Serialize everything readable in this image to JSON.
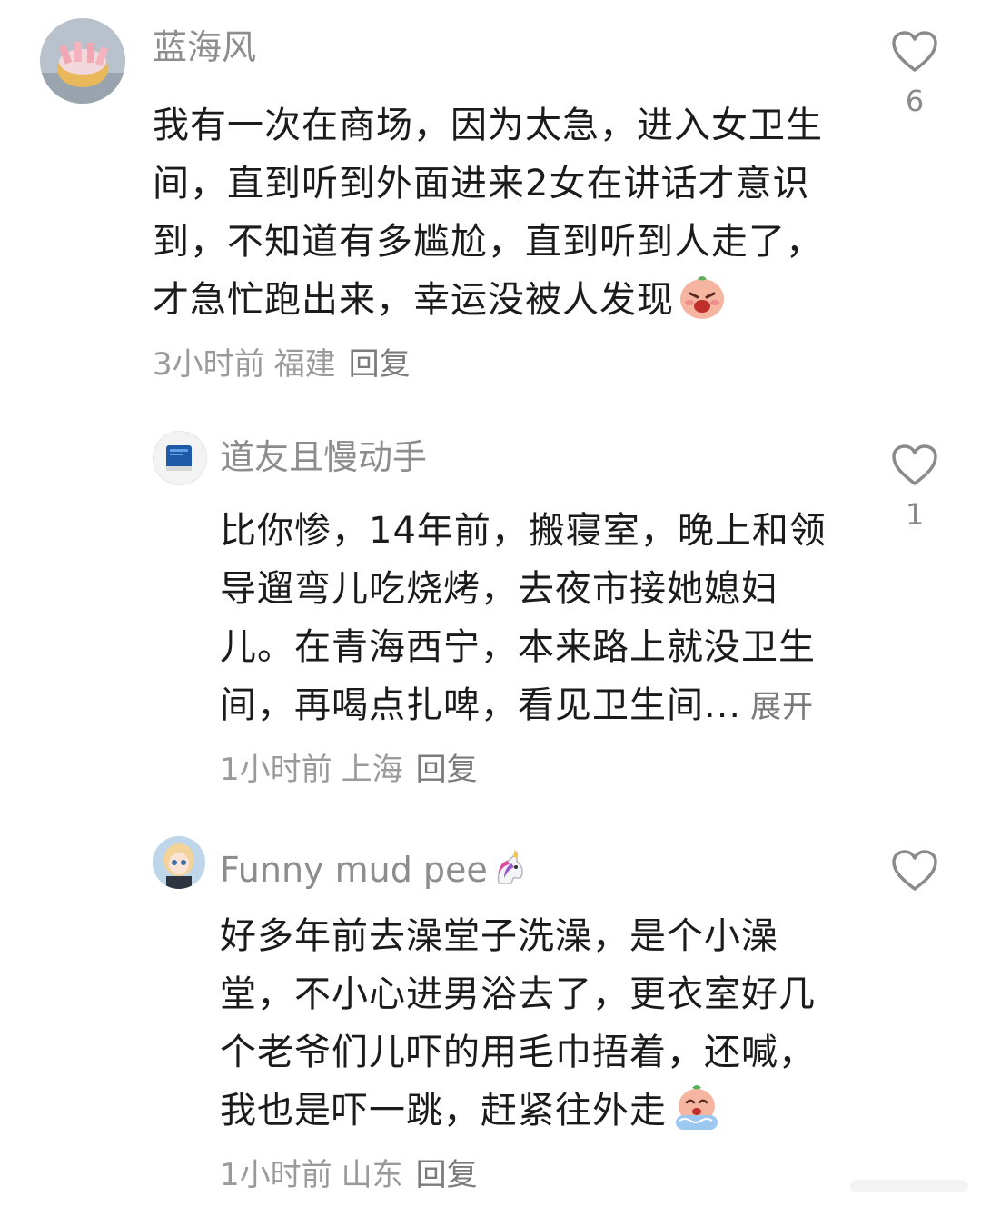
{
  "comments": [
    {
      "username": "蓝海风",
      "lines": [
        "我有一次在商场，因为太急，进入女卫生",
        "间，直到听到外面进来2女在讲话才意识",
        "到，不知道有多尴尬，直到听到人走了，",
        "才急忙跑出来，幸运没被人发现"
      ],
      "emoji": "embarrassed-emoji",
      "time": "3小时前",
      "location": "福建",
      "reply_label": "回复",
      "like_count": "6"
    },
    {
      "username": "道友且慢动手",
      "lines": [
        "比你惨，14年前，搬寝室，晚上和领",
        "导遛弯儿吃烧烤，去夜市接她媳妇",
        "儿。在青海西宁，本来路上就没卫生",
        "间，再喝点扎啤，看见卫生间..."
      ],
      "expand_label": "展开",
      "time": "1小时前",
      "location": "上海",
      "reply_label": "回复",
      "like_count": "1"
    },
    {
      "username": "Funny mud pee",
      "username_emoji": "unicorn-emoji",
      "lines": [
        "好多年前去澡堂子洗澡，是个小澡",
        "堂，不小心进男浴去了，更衣室好几",
        "个老爷们儿吓的用毛巾捂着，还喊，",
        "我也是吓一跳，赶紧往外走"
      ],
      "emoji": "crying-emoji",
      "time": "1小时前",
      "location": "山东",
      "reply_label": "回复",
      "like_count": ""
    }
  ],
  "colors": {
    "username": "#8d8d8d",
    "text": "#1b1b1b",
    "meta": "#9a9a9a",
    "icon": "#8a8a8a"
  }
}
